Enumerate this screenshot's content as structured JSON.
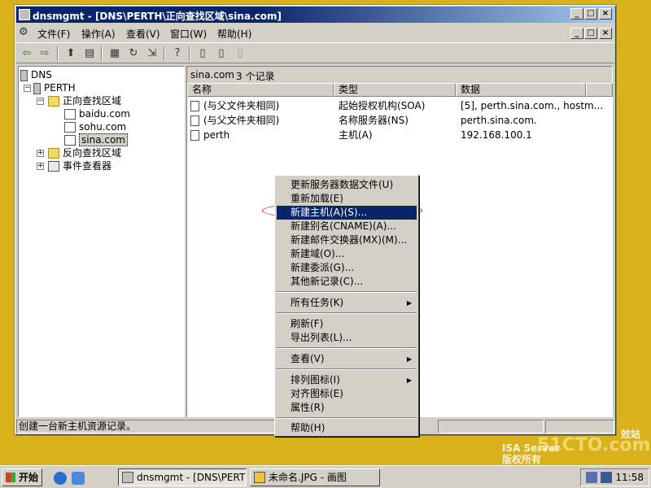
{
  "desktop": {
    "watermark_isa": "ISA Server",
    "watermark_rights": "版权所有",
    "watermark_site": "51CTO.com",
    "watermark_partial": "效站"
  },
  "window": {
    "icon": "dns-console-icon",
    "title": "dnsmgmt - [DNS\\PERTH\\正向查找区域\\sina.com]",
    "controls": [
      "_",
      "□",
      "×"
    ]
  },
  "menubar": {
    "items": [
      "文件(F)",
      "操作(A)",
      "查看(V)",
      "窗口(W)",
      "帮助(H)"
    ],
    "right_controls": [
      "_",
      "□",
      "×"
    ]
  },
  "toolbar": {
    "icons": [
      "back-icon",
      "forward-icon",
      "up-folder-icon",
      "show-hide-tree-icon",
      "properties-icon",
      "refresh-icon",
      "export-list-icon",
      "help-icon",
      "record-icon",
      "record-icon",
      "record-icon"
    ]
  },
  "tree": {
    "root": "DNS",
    "server": "PERTH",
    "forward_zones": "正向查找区域",
    "zones": [
      "baidu.com",
      "sohu.com",
      "sina.com"
    ],
    "reverse_zones": "反向查找区域",
    "event_viewer": "事件查看器"
  },
  "pane": {
    "header_zone": "sina.com",
    "header_count": "3 个记录",
    "columns": [
      "名称",
      "类型",
      "数据"
    ],
    "records": [
      {
        "name": "(与父文件夹相同)",
        "type": "起始授权机构(SOA)",
        "data": "[5], perth.sina.com., hostm..."
      },
      {
        "name": "(与父文件夹相同)",
        "type": "名称服务器(NS)",
        "data": "perth.sina.com."
      },
      {
        "name": "perth",
        "type": "主机(A)",
        "data": "192.168.100.1"
      }
    ]
  },
  "status": {
    "text": "创建一台新主机资源记录。"
  },
  "context_menu": {
    "items": [
      {
        "label": "更新服务器数据文件(U)"
      },
      {
        "label": "重新加载(E)"
      },
      {
        "label": "新建主机(A)(S)...",
        "highlighted": true
      },
      {
        "label": "新建别名(CNAME)(A)..."
      },
      {
        "label": "新建邮件交换器(MX)(M)..."
      },
      {
        "label": "新建域(O)..."
      },
      {
        "label": "新建委派(G)..."
      },
      {
        "label": "其他新记录(C)..."
      },
      {
        "label": "所有任务(K)",
        "submenu": true
      },
      {
        "label": "刷新(F)"
      },
      {
        "label": "导出列表(L)..."
      },
      {
        "label": "查看(V)",
        "submenu": true
      },
      {
        "label": "排列图标(I)",
        "submenu": true
      },
      {
        "label": "对齐图标(E)"
      },
      {
        "label": "属性(R)"
      },
      {
        "label": "帮助(H)"
      }
    ]
  },
  "taskbar": {
    "start": "开始",
    "tasks": [
      "dnsmgmt - [DNS\\PERTH\\...",
      "未命名.JPG - 画图"
    ],
    "clock": "11:58"
  },
  "colors": {
    "desktop": "#d9b11b",
    "title_active": "#0a246a",
    "highlight": "#0a246a",
    "annotation": "#d41a1a"
  }
}
